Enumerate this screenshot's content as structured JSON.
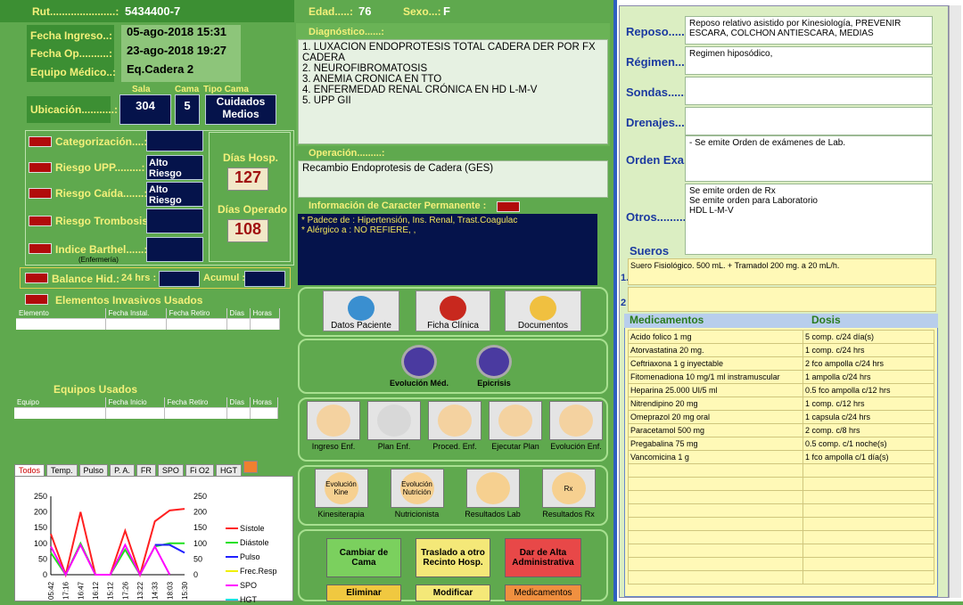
{
  "patient": {
    "rut_label": "Rut......................:",
    "rut": "5434400-7",
    "edad_label": "Edad.....:",
    "edad": "76",
    "sexo_label": "Sexo...:",
    "sexo": "F",
    "ingreso_label": "Fecha Ingreso..:",
    "ingreso": "05-ago-2018 15:31",
    "op_label": "Fecha Op..........:",
    "op": "23-ago-2018 19:27",
    "equipo_label": "Equipo Médico..:",
    "equipo": "Eq.Cadera 2",
    "ubic_label": "Ubicación...........:",
    "sala_label": "Sala",
    "sala": "304",
    "cama_label": "Cama",
    "cama": "5",
    "tipo_label": "Tipo Cama",
    "tipo": "Cuidados Medios"
  },
  "risk": {
    "cat": "Categorización....:",
    "upp": "Riesgo UPP.........:",
    "upp_val": "Alto Riesgo",
    "caida": "Riesgo Caída.......:",
    "caida_val": "Alto Riesgo",
    "tromb": "Riesgo Trombosis:",
    "barthel": "Indice Barthel......:",
    "enfermeria": "(Enfermería)",
    "dias_hosp_label": "Días Hosp.",
    "dias_hosp": "127",
    "dias_op_label": "Días Operado",
    "dias_op": "108",
    "balance": "Balance Hid.:",
    "hrs24": "24 hrs :",
    "acumul": "Acumul :"
  },
  "invasivos": {
    "title": "Elementos Invasivos Usados",
    "cols": [
      "Elemento",
      "Fecha Instal.",
      "Fecha Retiro",
      "Días",
      "Horas"
    ]
  },
  "equipos": {
    "title": "Equipos Usados",
    "cols": [
      "Equipo",
      "Fecha Inicio",
      "Fecha Retiro",
      "Días",
      "Horas"
    ]
  },
  "chart_tabs": [
    "Todos",
    "Temp.",
    "Pulso",
    "P. A.",
    "FR",
    "SPO",
    "Fi O2",
    "HGT"
  ],
  "diag": {
    "label": "Diagnóstico......:",
    "lines": [
      "1. LUXACION ENDOPROTESIS TOTAL CADERA DER POR FX CADERA",
      "2. NEUROFIBROMATOSIS",
      "3. ANEMIA CRONICA EN TTO",
      "4. ENFERMEDAD RENAL CRÓNICA EN HD L-M-V",
      "5. UPP GII"
    ]
  },
  "oper": {
    "label": "Operación.........:",
    "text": "Recambio Endoprotesis de Cadera (GES)"
  },
  "perm": {
    "label": "Información de Caracter Permanente :",
    "l1": "* Padece de : Hipertensión, Ins. Renal, Trast.Coagulac",
    "l2": "* Alérgico a : NO REFIERE, ,"
  },
  "buttons": {
    "datos": "Datos Paciente",
    "ficha": "Ficha Clínica",
    "docs": "Documentos",
    "evol": "Evolución Méd.",
    "epic": "Epicrisis",
    "ing": "Ingreso Enf.",
    "plan": "Plan Enf.",
    "proc": "Proced. Enf.",
    "ejec": "Ejecutar Plan",
    "evolenf": "Evolución Enf.",
    "kine_icon": "Evolución Kine",
    "nutri_icon": "Evolución Nutrición",
    "kine": "Kinesiterapia",
    "nutri": "Nutricionista",
    "lab": "Resultados Lab",
    "rx": "Resultados Rx",
    "cambiar": "Cambiar de Cama",
    "traslado": "Traslado a otro Recinto Hosp.",
    "alta": "Dar de Alta Administrativa",
    "eliminar": "Eliminar",
    "modificar": "Modificar",
    "medic": "Medicamentos"
  },
  "right": {
    "reposo_label": "Reposo......",
    "reposo": "Reposo relativo asistido por Kinesiología,  PREVENIR ESCARA,  COLCHON ANTIESCARA,  MEDIAS",
    "regimen_label": "Régimen.......",
    "regimen": "Regimen hiposódico,",
    "sondas_label": "Sondas.......",
    "drenajes_label": "Drenajes......",
    "orden_label": "Orden Exa.",
    "orden": "- Se emite Orden de exámenes de Lab.",
    "otros_label": "Otros..........",
    "otros": [
      "Se emite orden de Rx",
      "Se emite orden para Laboratorio",
      "HDL L-M-V"
    ],
    "sueros_label": "Sueros",
    "s1": "1.",
    "s2": "2",
    "suero1": "Suero Fisiológico. 500 mL. + Tramadol 200 mg. a 20 mL/h.",
    "med_label": "Medicamentos",
    "dosis_label": "Dosis"
  },
  "meds": [
    [
      "Acido folico 1 mg",
      "5 comp. c/24 día(s)"
    ],
    [
      "Atorvastatina 20 mg.",
      "1 comp. c/24 hrs"
    ],
    [
      "Ceftriaxona 1 g inyectable",
      "2 fco ampolla c/24 hrs"
    ],
    [
      "Fitomenadiona 10 mg/1 ml instramuscular",
      "1 ampolla c/24 hrs"
    ],
    [
      "Heparina 25.000 UI/5 ml",
      "0.5 fco ampolla c/12 hrs"
    ],
    [
      "Nitrendipino 20 mg",
      "1 comp. c/12 hrs"
    ],
    [
      "Omeprazol 20 mg oral",
      "1 capsula c/24 hrs"
    ],
    [
      "Paracetamol 500 mg",
      "2 comp. c/8 hrs"
    ],
    [
      "Pregabalina 75 mg",
      "0.5 comp. c/1 noche(s)"
    ],
    [
      "Vancomicina 1 g",
      "1 fco ampolla c/1 día(s)"
    ]
  ],
  "chart_data": {
    "type": "line",
    "x": [
      "05:42",
      "17:16",
      "16:47",
      "16:12",
      "15:12",
      "17:26",
      "13:22",
      "14:33",
      "18:03",
      "15:30"
    ],
    "ylim": [
      0,
      250
    ],
    "yticks": [
      0,
      50,
      100,
      150,
      200,
      250
    ],
    "series": [
      {
        "name": "Sístole",
        "color": "#ff2020",
        "values": [
          130,
          0,
          200,
          0,
          0,
          140,
          0,
          170,
          205,
          210
        ]
      },
      {
        "name": "Diástole",
        "color": "#20e020",
        "values": [
          70,
          0,
          100,
          0,
          0,
          80,
          0,
          90,
          100,
          100
        ]
      },
      {
        "name": "Pulso",
        "color": "#2020ff",
        "values": [
          null,
          null,
          null,
          null,
          null,
          null,
          null,
          95,
          95,
          70
        ]
      },
      {
        "name": "Frec.Resp",
        "color": "#f0f000",
        "values": [
          null,
          null,
          null,
          null,
          null,
          null,
          null,
          null,
          null,
          null
        ]
      },
      {
        "name": "SPO",
        "color": "#ff00ff",
        "values": [
          90,
          0,
          95,
          0,
          0,
          95,
          0,
          90,
          0,
          null
        ]
      },
      {
        "name": "HGT",
        "color": "#00e0e0",
        "values": [
          null,
          null,
          null,
          null,
          null,
          null,
          null,
          null,
          null,
          null
        ]
      }
    ]
  }
}
